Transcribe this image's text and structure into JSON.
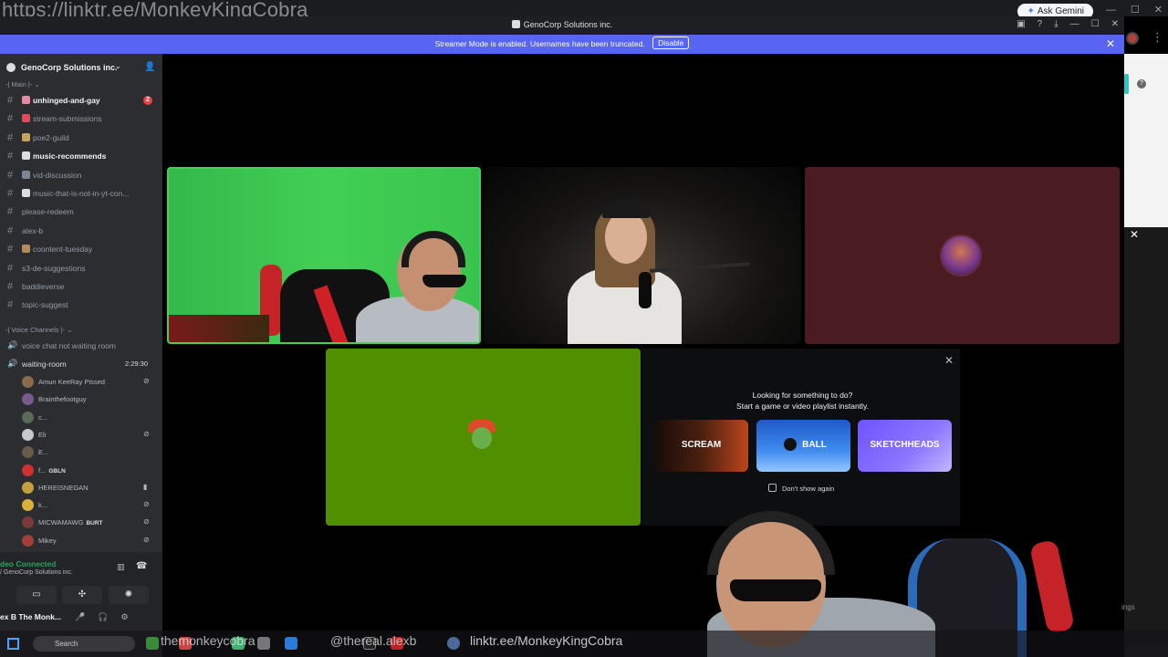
{
  "overlay": {
    "top_url": "https://linktr.ee/MonkeyKingCobra",
    "handle_1": "themonkeycobra",
    "handle_2": "@thereal.alexb",
    "link": "linktr.ee/MonkeyKingCobra"
  },
  "browser": {
    "ask_gemini": "Ask Gemini"
  },
  "window": {
    "title": "GenoCorp Solutions inc."
  },
  "banner": {
    "text": "Streamer Mode is enabled. Usernames have been truncated.",
    "disable_label": "Disable"
  },
  "server": {
    "name": "GenoCorp Solutions inc.",
    "categories": {
      "main": "-| Main |-",
      "voice": "-| Voice Channels |-"
    },
    "channels": [
      {
        "label": "unhinged-and-gay",
        "unread": true,
        "badge": "2",
        "emoji_color": "#e88aa5"
      },
      {
        "label": "stream-submissions",
        "unread": false,
        "emoji_color": "#e04d5a"
      },
      {
        "label": "poe2-guild",
        "unread": false,
        "emoji_color": "#c8a35a"
      },
      {
        "label": "music-recommends",
        "unread": true,
        "emoji_color": "#dbdee1"
      },
      {
        "label": "vid-discussion",
        "unread": false,
        "emoji_color": "#7c8694"
      },
      {
        "label": "music-that-is-not-in-yt-con...",
        "unread": false,
        "emoji_color": "#dbdee1"
      },
      {
        "label": "please-redeem",
        "unread": false
      },
      {
        "label": "alex-b",
        "unread": false
      },
      {
        "label": "coontent-tuesday",
        "unread": false,
        "emoji_color": "#b38b5a"
      },
      {
        "label": "s3-de-suggestions",
        "unread": false
      },
      {
        "label": "baddieverse",
        "unread": false
      },
      {
        "label": "topic-suggest",
        "unread": false
      }
    ],
    "voice_channels": [
      {
        "label": "voice chat not waiting room"
      },
      {
        "label": "waiting-room",
        "timer": "2:29:30"
      }
    ],
    "voice_users": [
      {
        "name": "Amun KeeRay Pissed",
        "status": "⊘",
        "avatar": "#8a6b4a"
      },
      {
        "name": "Brainthefootguy",
        "status": "",
        "avatar": "#7a5a8a"
      },
      {
        "name": "c...",
        "status": "",
        "avatar": "#5a6a5a"
      },
      {
        "name": "Eli",
        "status": "⊘",
        "avatar": "#c9c9c9"
      },
      {
        "name": "E...",
        "status": "",
        "avatar": "#6a5a4a"
      },
      {
        "name": "f...",
        "tag": "GBLN",
        "status": "",
        "avatar": "#d03030"
      },
      {
        "name": "HEREISNEGAN",
        "status": "▮",
        "avatar": "#c2a040"
      },
      {
        "name": "k...",
        "status": "⊘",
        "avatar": "#d8b03a"
      },
      {
        "name": "MICWAMAWG",
        "tag": "BURT",
        "status": "⊘",
        "avatar": "#7a3a3a"
      },
      {
        "name": "Mikey",
        "status": "⊘",
        "avatar": "#a0403a"
      }
    ],
    "voice_panel": {
      "title": "deo Connected",
      "subtitle": "/ GenoCorp Solutions inc."
    },
    "user": {
      "name": "ex B The Monk..."
    }
  },
  "activity": {
    "title_line1": "Looking for something to do?",
    "title_line2": "Start a game or video playlist instantly.",
    "cards": [
      {
        "caption": "SCREAM"
      },
      {
        "caption": "BALL"
      },
      {
        "caption": "SKETCHHEADS"
      }
    ],
    "dont_show": "Don't show again"
  },
  "taskbar": {
    "search_placeholder": "Search"
  },
  "right_panel": {
    "settings_fragment": "ings"
  }
}
